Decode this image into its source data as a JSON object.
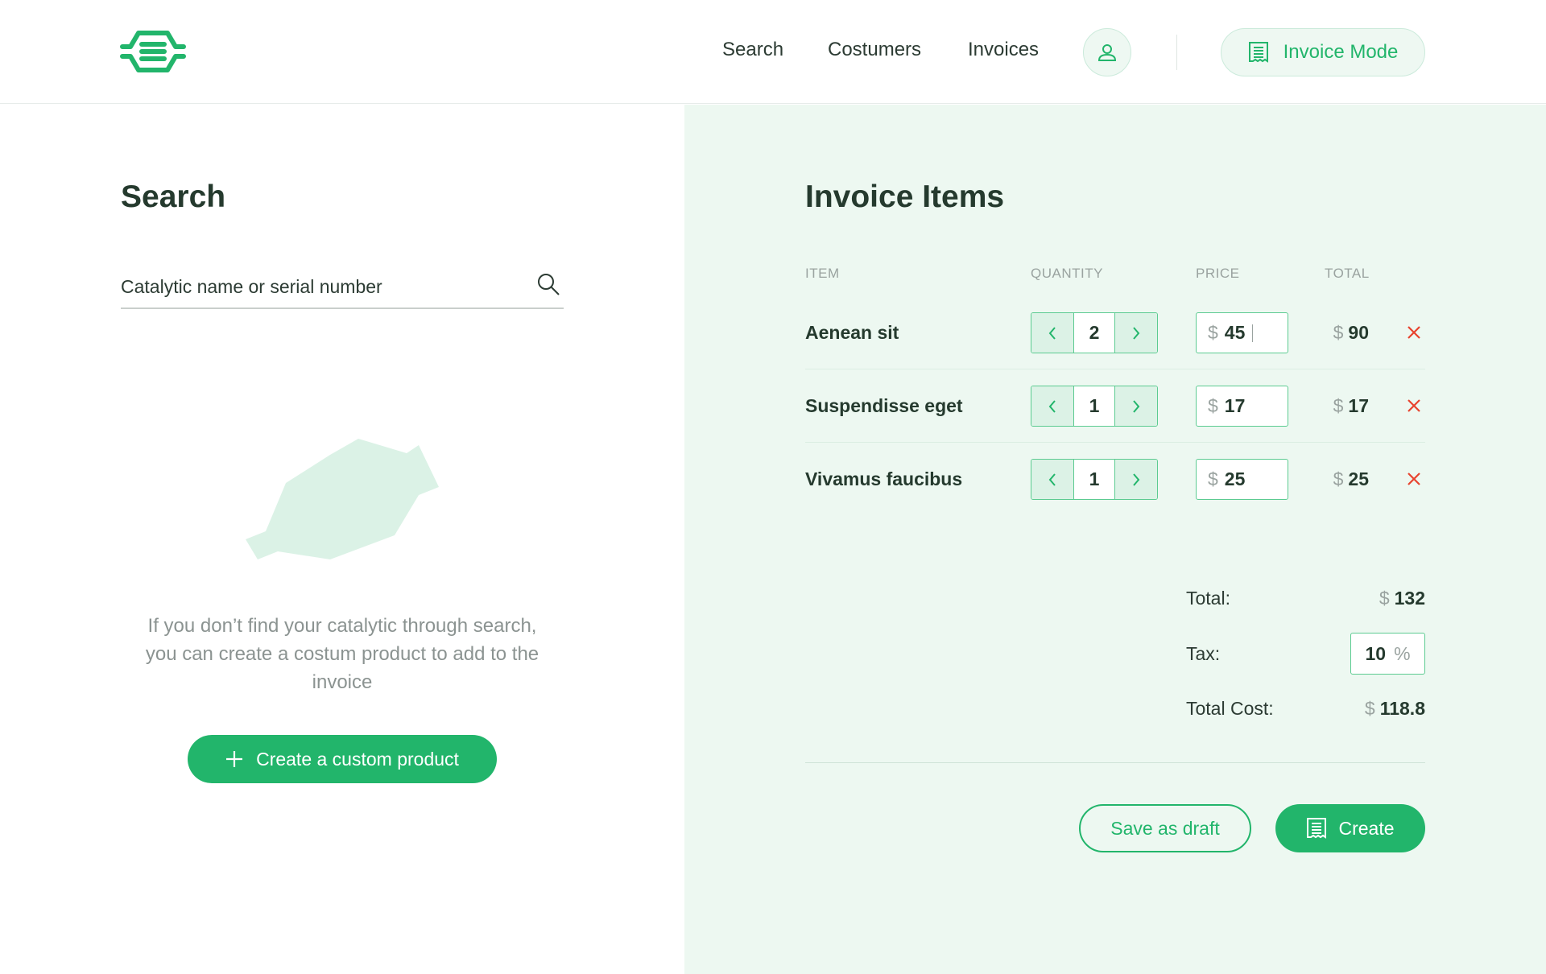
{
  "header": {
    "nav": [
      {
        "label": "Search"
      },
      {
        "label": "Costumers"
      },
      {
        "label": "Invoices"
      }
    ],
    "mode_button": "Invoice Mode",
    "icons": {
      "logo": "app-logo",
      "user": "user-icon",
      "invoice": "receipt-icon"
    }
  },
  "search": {
    "title": "Search",
    "placeholder": "Catalytic name or serial number",
    "empty_text": "If you don’t find your catalytic through search, you can create a costum product to add to the invoice",
    "custom_button": "Create a custom product"
  },
  "invoice": {
    "title": "Invoice Items",
    "columns": {
      "item": "ITEM",
      "quantity": "QUANTITY",
      "price": "PRICE",
      "total": "TOTAL"
    },
    "currency": "$",
    "items": [
      {
        "name": "Aenean sit",
        "quantity": "2",
        "price": "45",
        "total": "90"
      },
      {
        "name": "Suspendisse eget",
        "quantity": "1",
        "price": "17",
        "total": "17"
      },
      {
        "name": "Vivamus faucibus",
        "quantity": "1",
        "price": "25",
        "total": "25"
      }
    ],
    "summary": {
      "total_label": "Total:",
      "total_value": "132",
      "tax_label": "Tax:",
      "tax_value": "10",
      "tax_unit": "%",
      "cost_label": "Total Cost:",
      "cost_value": "118.8"
    },
    "draft_button": "Save as draft",
    "create_button": "Create"
  },
  "colors": {
    "accent": "#22b56b",
    "panel": "#edf8f1",
    "danger": "#e8432e"
  }
}
